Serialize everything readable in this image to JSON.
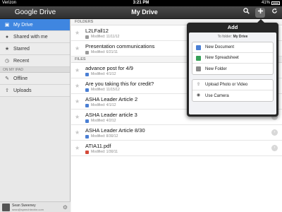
{
  "status_bar": {
    "carrier": "Verizon",
    "time": "3:21 PM",
    "battery": "41%"
  },
  "header": {
    "app_title_prefix": "Google",
    "app_title_suffix": "Drive",
    "page_title": "My Drive",
    "icons": [
      "search-icon",
      "add-icon",
      "refresh-icon"
    ]
  },
  "sidebar": {
    "items": [
      {
        "label": "My Drive",
        "icon": "drive-icon",
        "active": true
      },
      {
        "label": "Shared with me",
        "icon": "people-icon",
        "active": false
      },
      {
        "label": "Starred",
        "icon": "star-icon",
        "active": false
      },
      {
        "label": "Recent",
        "icon": "clock-icon",
        "active": false
      }
    ],
    "section_label": "ON MY IPAD",
    "device_items": [
      {
        "label": "Offline",
        "icon": "pin-icon"
      },
      {
        "label": "Uploads",
        "icon": "upload-icon"
      }
    ],
    "user": {
      "name": "Sean Sweeney",
      "email": "sean@speechtechie.com"
    }
  },
  "main": {
    "folders_header": "FOLDERS",
    "files_header": "FILES",
    "folders": [
      {
        "name": "L2LFall12",
        "modified": "Modified: 11/11/12",
        "type": "folder"
      },
      {
        "name": "Presentation communications",
        "modified": "Modified: 6/21/11",
        "type": "folder"
      }
    ],
    "files": [
      {
        "name": "advance post for 4/9",
        "modified": "Modified: 4/1/12",
        "type": "doc",
        "has_chevron": false
      },
      {
        "name": "Are you taking this for credit?",
        "modified": "Modified: 11/15/12",
        "type": "doc",
        "has_chevron": false
      },
      {
        "name": "ASHA Leader Article 2",
        "modified": "Modified: 4/1/12",
        "type": "doc",
        "has_chevron": true
      },
      {
        "name": "ASHA Leader article 3",
        "modified": "Modified: 4/2/12",
        "type": "doc",
        "has_chevron": true
      },
      {
        "name": "ASHA Leader Article 8/30",
        "modified": "Modified: 8/30/12",
        "type": "doc",
        "has_chevron": true
      },
      {
        "name": "ATIA11.pdf",
        "modified": "Modified: 1/30/11",
        "type": "pdf",
        "has_chevron": true
      }
    ]
  },
  "popover": {
    "title": "Add",
    "to_folder_prefix": "To folder:",
    "to_folder_name": "My Drive",
    "create_items": [
      {
        "label": "New Document",
        "icon": "document-icon"
      },
      {
        "label": "New Spreadsheet",
        "icon": "spreadsheet-icon"
      },
      {
        "label": "New Folder",
        "icon": "folder-icon"
      }
    ],
    "upload_items": [
      {
        "label": "Upload Photo or Video",
        "icon": "upload-icon"
      },
      {
        "label": "Use Camera",
        "icon": "camera-icon"
      }
    ]
  },
  "colors": {
    "accent": "#3f86e0",
    "header_bg": "#3a3a3a",
    "popover_bg": "#262626"
  }
}
